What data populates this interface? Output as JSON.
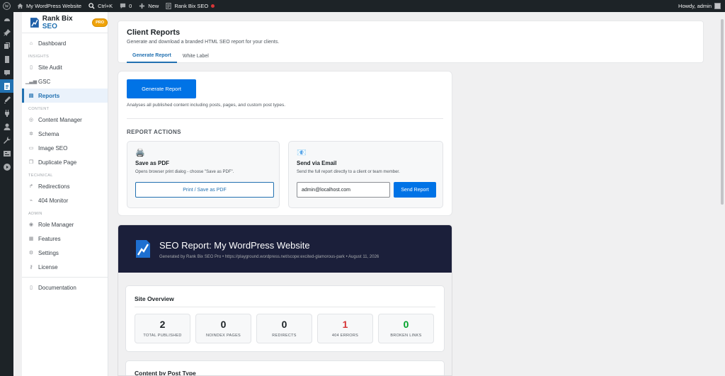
{
  "adminbar": {
    "site_name": "My WordPress Website",
    "search_shortcut": "Ctrl+K",
    "comments_count": "0",
    "new_label": "New",
    "plugin_label": "Rank Bix SEO",
    "greeting": "Howdy, admin"
  },
  "wp_menu_icons": [
    "dashboard-icon",
    "pin-icon",
    "media-icon",
    "pages-icon",
    "comments-icon",
    "rankbix-icon",
    "appearance-icon",
    "plugins-icon",
    "users-icon",
    "tools-icon",
    "settings-icon",
    "play-icon"
  ],
  "brand": {
    "name": "Rank Bix",
    "seo": "SEO",
    "badge": "PRO"
  },
  "sidebar": {
    "dashboard": "Dashboard",
    "group_insights": "INSIGHTS",
    "site_audit": "Site Audit",
    "gsc": "GSC",
    "reports": "Reports",
    "group_content": "CONTENT",
    "content_manager": "Content Manager",
    "schema": "Schema",
    "image_seo": "Image SEO",
    "duplicate_page": "Duplicate Page",
    "group_technical": "TECHNICAL",
    "redirections": "Redirections",
    "monitor_404": "404 Monitor",
    "group_admin": "ADMIN",
    "role_manager": "Role Manager",
    "features": "Features",
    "settings": "Settings",
    "license": "License",
    "documentation": "Documentation"
  },
  "header": {
    "title": "Client Reports",
    "subtitle": "Generate and download a branded HTML SEO report for your clients.",
    "tabs": [
      "Generate Report",
      "White Label"
    ]
  },
  "generate": {
    "button": "Generate Report",
    "help": "Analyses all published content including posts, pages, and custom post types.",
    "actions_title": "REPORT ACTIONS",
    "pdf": {
      "icon": "🖨️",
      "title": "Save as PDF",
      "desc": "Opens browser print dialog - choose \"Save as PDF\".",
      "button": "Print / Save as PDF"
    },
    "email": {
      "icon": "📧",
      "title": "Send via Email",
      "desc": "Send the full report directly to a client or team member.",
      "input_value": "admin@localhost.com",
      "button": "Send Report"
    }
  },
  "report": {
    "title": "SEO Report: My WordPress Website",
    "generated": "Generated by Rank Bix SEO Pro • https://playground.wordpress.net/scope:excited-glamorous-park • August 11, 2026",
    "overview_title": "Site Overview",
    "stats": [
      {
        "value": "2",
        "label": "TOTAL PUBLISHED",
        "color": "#1d2327"
      },
      {
        "value": "0",
        "label": "NOINDEX PAGES",
        "color": "#1d2327"
      },
      {
        "value": "0",
        "label": "REDIRECTS",
        "color": "#1d2327"
      },
      {
        "value": "1",
        "label": "404 ERRORS",
        "color": "#d63638"
      },
      {
        "value": "0",
        "label": "BROKEN LINKS",
        "color": "#00a32a"
      }
    ],
    "content_title": "Content by Post Type"
  },
  "colors": {
    "accent": "#2271b1",
    "primary_button": "#0073e6",
    "report_header": "#1b1f3a",
    "pro_badge": "#f0a30a"
  }
}
